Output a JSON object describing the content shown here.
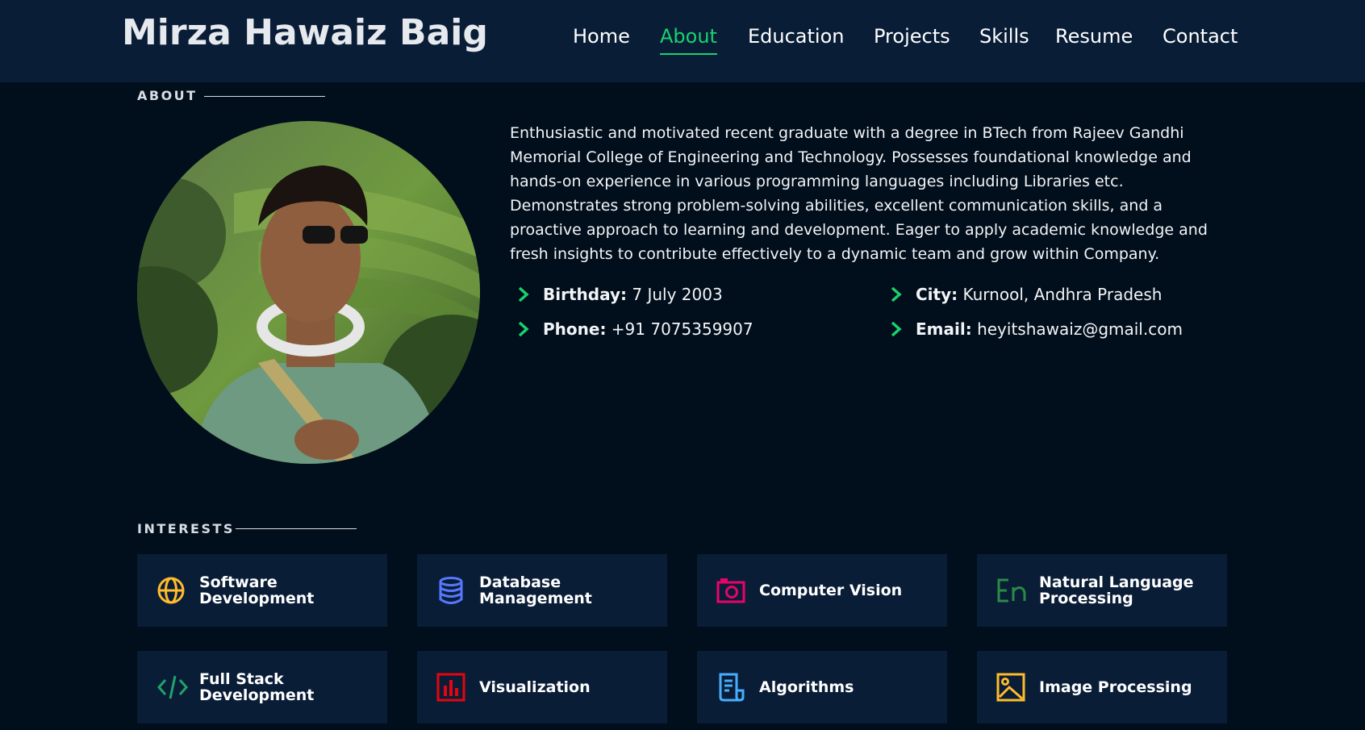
{
  "header": {
    "brand": "Mirza Hawaiz Baig",
    "nav": [
      {
        "label": "Home",
        "active": false
      },
      {
        "label": "About",
        "active": true
      },
      {
        "label": "Education",
        "active": false
      },
      {
        "label": "Projects",
        "active": false
      },
      {
        "label": "Skills",
        "active": false
      },
      {
        "label": "Resume",
        "active": false
      },
      {
        "label": "Contact",
        "active": false
      }
    ]
  },
  "about": {
    "section_title": "ABOUT",
    "description": "Enthusiastic and motivated recent graduate with a degree in BTech from Rajeev Gandhi Memorial College of Engineering and Technology. Possesses foundational knowledge and hands-on experience in various programming languages including Libraries etc. Demonstrates strong problem-solving abilities, excellent communication skills, and a proactive approach to learning and development. Eager to apply academic knowledge and fresh insights to contribute effectively to a dynamic team and grow within Company.",
    "info": {
      "birthday": {
        "label": "Birthday:",
        "value": "7 July 2003"
      },
      "phone": {
        "label": "Phone:",
        "value": "+91 7075359907"
      },
      "city": {
        "label": "City:",
        "value": "Kurnool, Andhra Pradesh"
      },
      "email": {
        "label": "Email:",
        "value": "heyitshawaiz@gmail.com"
      }
    }
  },
  "interests": {
    "section_title": "INTERESTS",
    "items": [
      {
        "label": "Software Development",
        "icon": "globe-icon",
        "color": "#ffbb2c"
      },
      {
        "label": "Database Management",
        "icon": "database-icon",
        "color": "#5578ff"
      },
      {
        "label": "Computer Vision",
        "icon": "camera-icon",
        "color": "#e80368"
      },
      {
        "label": "Natural Language Processing",
        "icon": "language-icon",
        "color": "#11dbcf"
      },
      {
        "label": "Full Stack Development",
        "icon": "code-icon",
        "color": "#47aeff"
      },
      {
        "label": "Visualization",
        "icon": "bar-chart-icon",
        "color": "#e5050f"
      },
      {
        "label": "Algorithms",
        "icon": "document-icon",
        "color": "#47aeff"
      },
      {
        "label": "Image Processing",
        "icon": "image-icon",
        "color": "#ffa76e"
      }
    ]
  },
  "colors": {
    "accent": "#18d26e",
    "header_bg": "#0a1d37",
    "page_bg": "#010e1b",
    "card_bg": "#0a1d37"
  }
}
